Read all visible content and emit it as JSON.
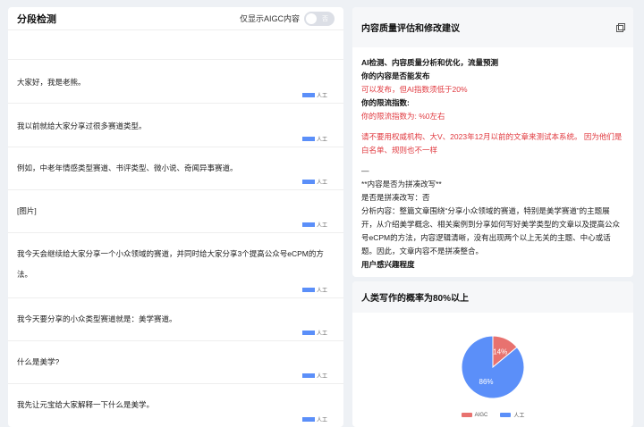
{
  "left": {
    "title": "分段检测",
    "toggle_label": "仅显示AIGC内容",
    "toggle_text": "否",
    "paragraphs": [
      {
        "text": "大家好，我是老熊。",
        "tag": "人工"
      },
      {
        "text": "我以前就给大家分享过很多赛道类型。",
        "tag": "人工"
      },
      {
        "text": "例如，中老年情感类型赛道、书评类型、微小说、奇闻异事赛道。",
        "tag": "人工"
      },
      {
        "text": "[图片]",
        "tag": "人工"
      },
      {
        "text": "我今天会继续给大家分享一个小众领域的赛道，并同时给大家分享3个提高公众号eCPM的方",
        "text2": "法。",
        "tag": "人工"
      },
      {
        "text": "我今天要分享的小众类型赛道就是：美学赛道。",
        "tag": "人工"
      },
      {
        "text": "什么是美学?",
        "tag": "人工"
      },
      {
        "text": "我先让元宝给大家解释一下什么是美学。",
        "tag": "人工"
      }
    ]
  },
  "right_top": {
    "title": "内容质量评估和修改建议",
    "heading": "AI检测、内容质量分析和优化，流量预测",
    "q1": "你的内容是否能发布",
    "a1": "可以发布，但AI指数须低于20%",
    "q2": "你的限流指数:",
    "a2": "你的限流指数为: %0左右",
    "warning": "请不要用权威机构、大V、2023年12月以前的文章来测试本系统。 因为他们是白名单、规则也不一样",
    "divider": "—",
    "section": "**内容是否为拼凑改写**",
    "is_patch": "是否是拼凑改写：否",
    "analysis": "分析内容：整篇文章围绕“分享小众领域的赛道，特别是美学赛道”的主题展开，从介绍美学概念、相关案例到分享如何写好美学类型的文章以及提高公众号eCPM的方法，内容逻辑清晰，没有出现两个以上无关的主题、中心或话题。因此，文章内容不是拼凑整合。",
    "interest": "用户感兴趣程度"
  },
  "right_bottom": {
    "title": "人类写作的概率为80%以上"
  },
  "chart_data": {
    "type": "pie",
    "title": "",
    "categories": [
      "AIGC",
      "人工"
    ],
    "values": [
      14,
      86
    ],
    "labels": [
      "14%",
      "86%"
    ],
    "colors": [
      "#e8726f",
      "#5b8ff9"
    ],
    "legend": "bottom"
  }
}
